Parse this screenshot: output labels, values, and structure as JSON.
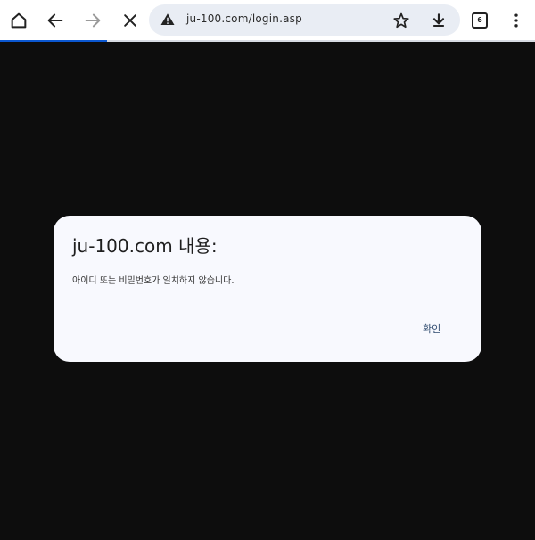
{
  "browser": {
    "url": "ju-100.com/login.asp",
    "tab_count": "6",
    "load_progress": 0.2,
    "icons": {
      "home": "home-icon",
      "back": "back-arrow-icon",
      "forward": "forward-arrow-icon",
      "stop": "close-icon",
      "security": "warning-icon",
      "bookmark": "star-icon",
      "download": "download-icon",
      "tabs": "tab-switcher-icon",
      "menu": "more-vert-icon"
    },
    "accent_color": "#0b57d0"
  },
  "dialog": {
    "title": "ju-100.com 내용:",
    "message": "아이디 또는 비밀번호가 일치하지 않습니다.",
    "ok_label": "확인"
  }
}
